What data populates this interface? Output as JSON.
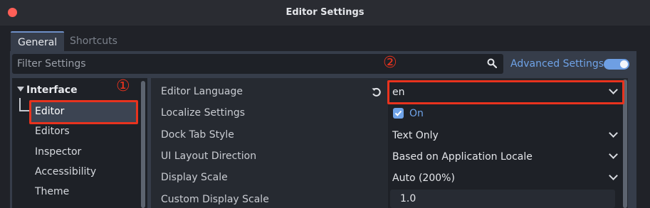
{
  "window": {
    "title": "Editor Settings"
  },
  "tabs": [
    {
      "label": "General"
    },
    {
      "label": "Shortcuts"
    }
  ],
  "filter": {
    "placeholder": "Filter Settings"
  },
  "advanced": {
    "label": "Advanced Settings",
    "enabled": true
  },
  "sidebar": {
    "heading": "Interface",
    "items": [
      {
        "label": "Editor"
      },
      {
        "label": "Editors"
      },
      {
        "label": "Inspector"
      },
      {
        "label": "Accessibility"
      },
      {
        "label": "Theme"
      }
    ]
  },
  "settings": [
    {
      "label": "Editor Language",
      "value": "en"
    },
    {
      "label": "Localize Settings",
      "value": "On"
    },
    {
      "label": "Dock Tab Style",
      "value": "Text Only"
    },
    {
      "label": "UI Layout Direction",
      "value": "Based on Application Locale"
    },
    {
      "label": "Display Scale",
      "value": "Auto (200%)"
    },
    {
      "label": "Custom Display Scale",
      "value": "1.0"
    }
  ],
  "annotations": {
    "marker_1": "①",
    "marker_2": "②"
  },
  "colors": {
    "accent": "#6fa3e8",
    "highlight": "#e8331e",
    "close": "#ff5f57"
  }
}
